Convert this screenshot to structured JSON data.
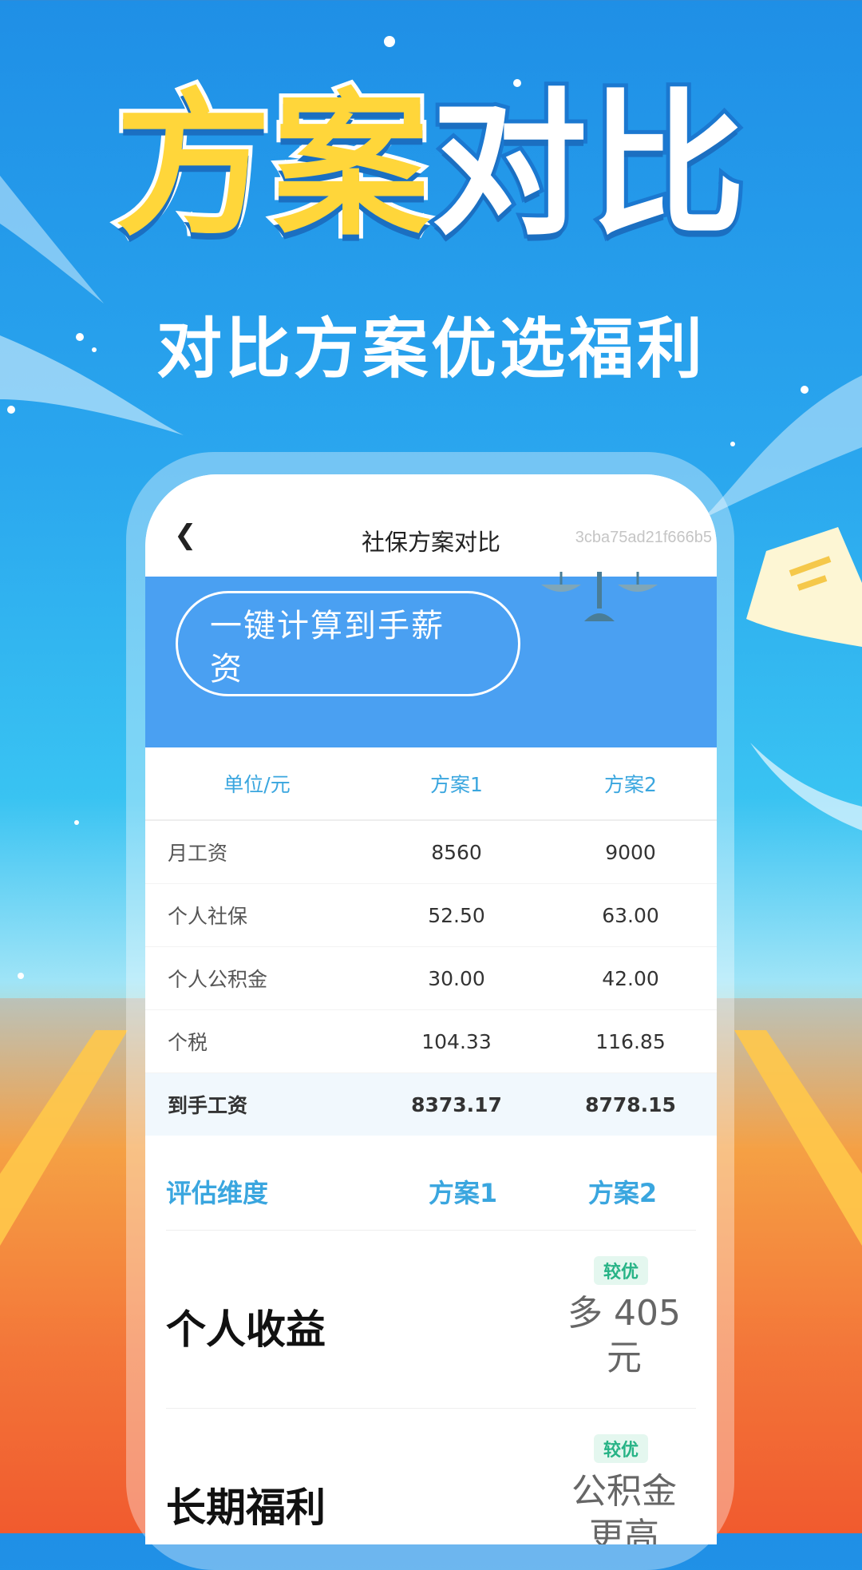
{
  "promo": {
    "title_part1": "方案",
    "title_part2": "对比",
    "subtitle": "对比方案优选福利"
  },
  "nav": {
    "back_icon": "chevron-left-icon",
    "title": "社保方案对比",
    "id_text": "3cba75ad21f666b5"
  },
  "banner": {
    "button_label_line1": "一键计算到手薪",
    "button_label_line2": "资",
    "icon": "scale-icon"
  },
  "table": {
    "headers": [
      "单位/元",
      "方案1",
      "方案2"
    ],
    "rows": [
      {
        "label": "月工资",
        "plan1": "8560",
        "plan2": "9000"
      },
      {
        "label": "个人社保",
        "plan1": "52.50",
        "plan2": "63.00"
      },
      {
        "label": "个人公积金",
        "plan1": "30.00",
        "plan2": "42.00"
      },
      {
        "label": "个税",
        "plan1": "104.33",
        "plan2": "116.85"
      },
      {
        "label": "到手工资",
        "plan1": "8373.17",
        "plan2": "8778.15"
      }
    ]
  },
  "evaluation": {
    "headers": [
      "评估维度",
      "方案1",
      "方案2"
    ],
    "rows": [
      {
        "label": "个人收益",
        "badge": "较优",
        "value_line1": "多 405",
        "value_line2": "元"
      },
      {
        "label": "长期福利",
        "badge": "较优",
        "value_line1": "公积金",
        "value_line2": "更高"
      }
    ]
  },
  "colors": {
    "accent_blue": "#3aa6df",
    "banner_blue": "#4aa0f2",
    "title_yellow": "#ffd63a",
    "badge_green": "#27b386"
  }
}
